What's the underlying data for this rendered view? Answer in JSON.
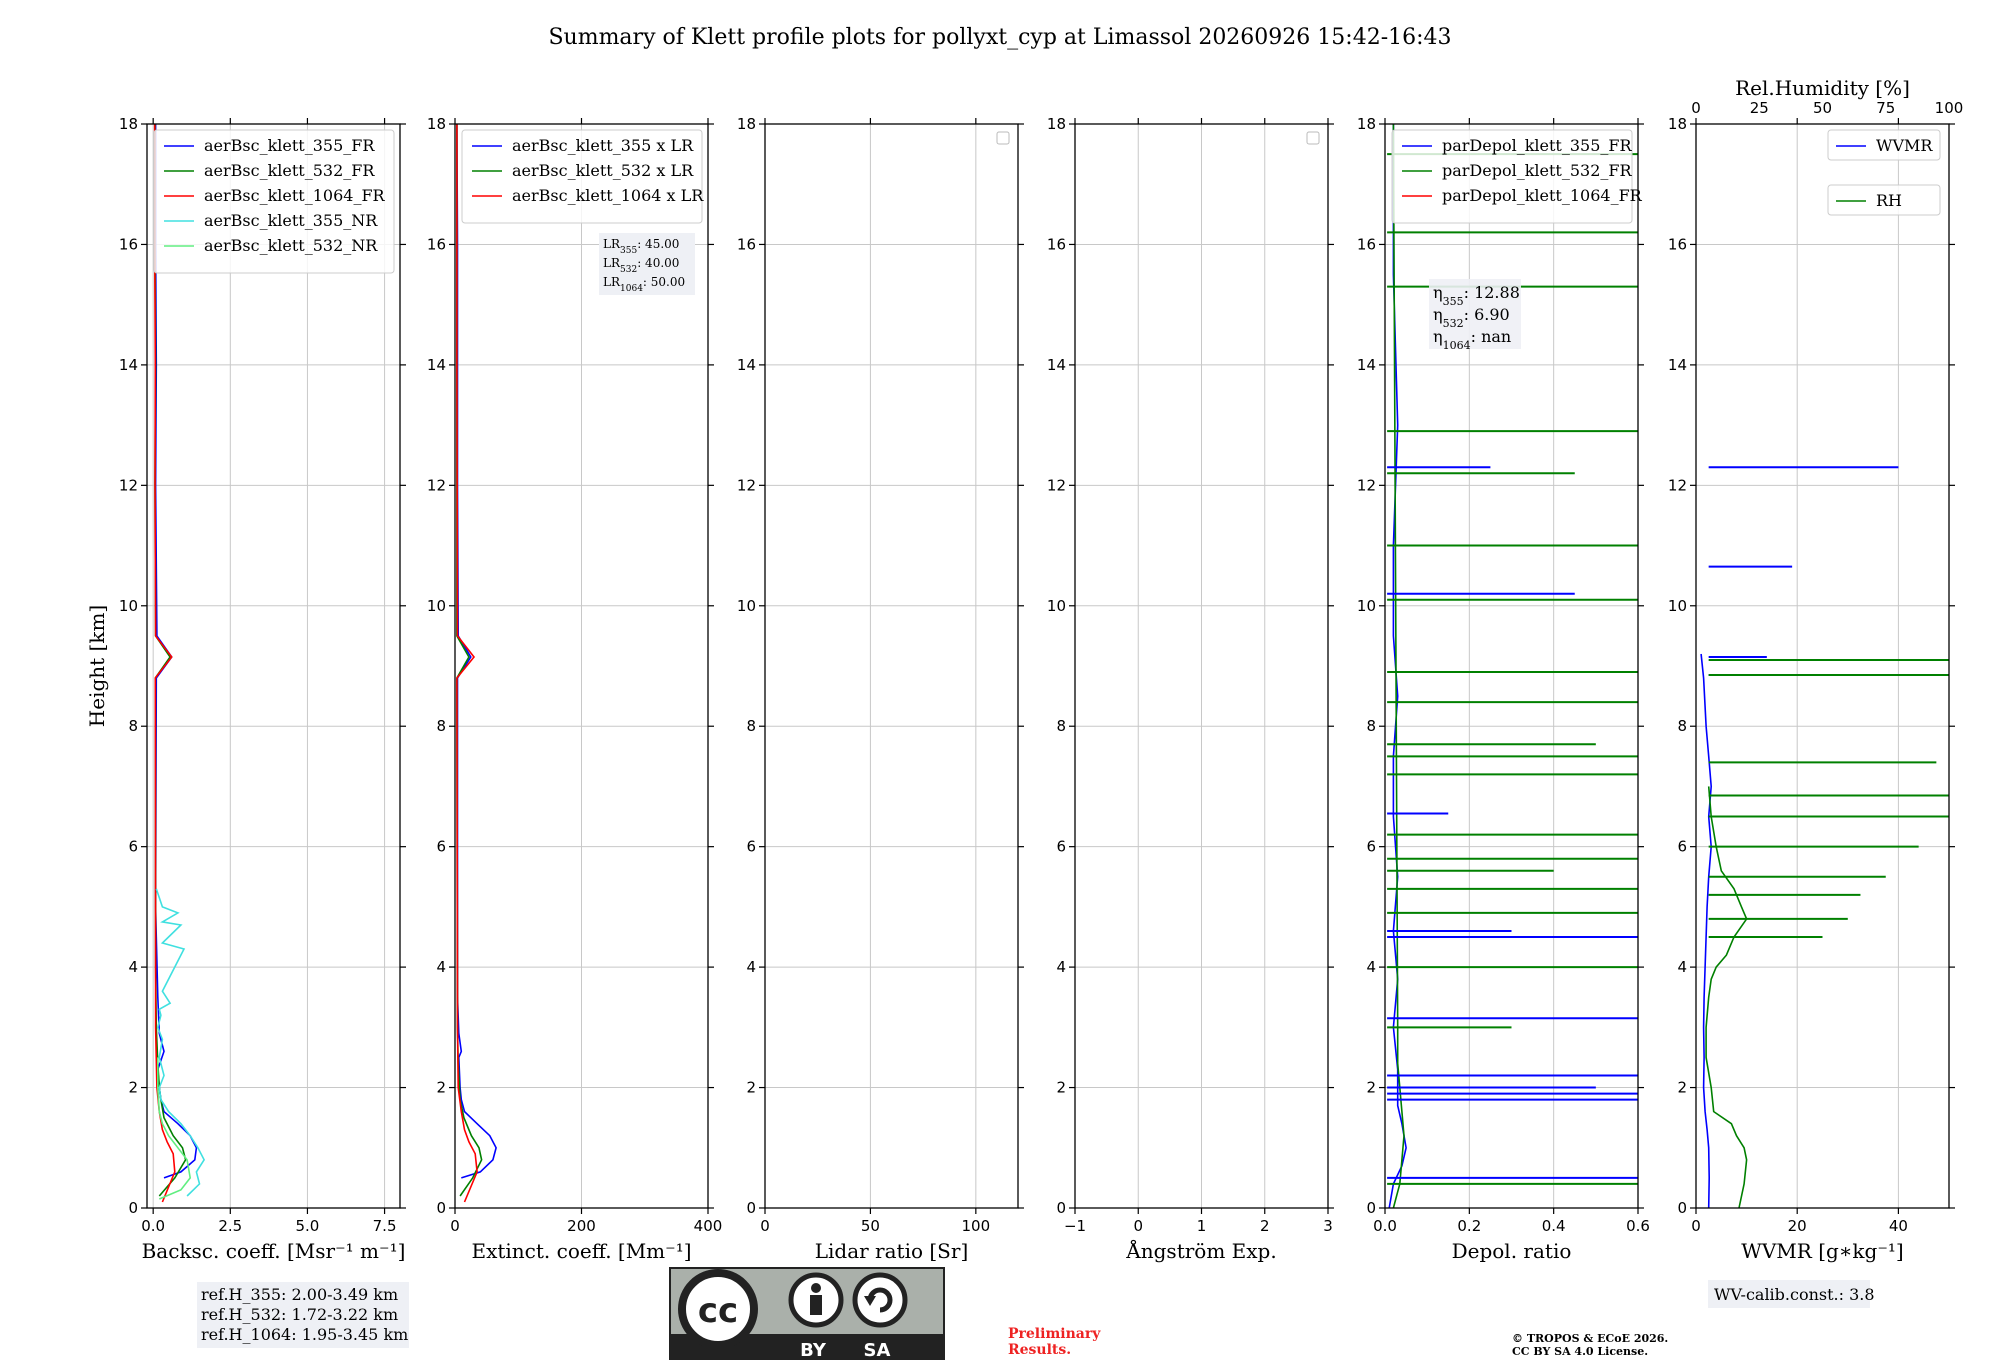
{
  "figure": {
    "title": "Summary of Klett profile plots for pollyxt_cyp at Limassol 20260926 15:42-16:43",
    "preliminary": [
      "Preliminary",
      "Results."
    ],
    "copyright": [
      "© TROPOS & ECoE 2026.",
      "CC BY SA 4.0 License."
    ],
    "cc_badge": {
      "left": "BY",
      "right": "SA"
    },
    "colors": {
      "blue": "#0000ff",
      "green": "#008000",
      "red": "#ff0000",
      "cyan": "#40e0e0",
      "lightgreen": "#60ee80",
      "grid": "#c8c8c8"
    }
  },
  "chart_data": [
    {
      "type": "line",
      "xlabel": "Backsc. coeff. [Msr⁻¹ m⁻¹]",
      "ylabel": "Height [km]",
      "xlim": [
        -0.2,
        8.0
      ],
      "ylim": [
        0,
        18
      ],
      "xticks": [
        0,
        2.5,
        5.0,
        7.5
      ],
      "xtick_labels": [
        "0.0",
        "2.5",
        "5.0",
        "7.5"
      ],
      "yticks": [
        0,
        2,
        4,
        6,
        8,
        10,
        12,
        14,
        16,
        18
      ],
      "legend": {
        "loc": "upper-right",
        "entries": [
          {
            "name": "aerBsc_klett_355_FR",
            "color": "#0000ff"
          },
          {
            "name": "aerBsc_klett_532_FR",
            "color": "#008000"
          },
          {
            "name": "aerBsc_klett_1064_FR",
            "color": "#ff0000"
          },
          {
            "name": "aerBsc_klett_355_NR",
            "color": "#40e0e0"
          },
          {
            "name": "aerBsc_klett_532_NR",
            "color": "#60ee80"
          }
        ]
      },
      "series": [
        {
          "name": "aerBsc_klett_355_FR",
          "color": "#0000ff",
          "x": [
            0.35,
            0.9,
            1.35,
            1.4,
            1.2,
            0.8,
            0.35,
            0.25,
            0.2,
            0.15,
            0.35,
            0.2,
            0.15,
            0.1,
            0.08,
            0.1,
            0.6,
            0.12,
            0.08,
            0.1,
            0.08,
            0.08
          ],
          "y": [
            0.5,
            0.6,
            0.8,
            1.0,
            1.2,
            1.4,
            1.6,
            1.8,
            2.0,
            2.3,
            2.6,
            2.9,
            3.5,
            4.5,
            5.0,
            8.8,
            9.15,
            9.5,
            12.0,
            14.0,
            16.0,
            18.0
          ]
        },
        {
          "name": "aerBsc_klett_532_FR",
          "color": "#008000",
          "x": [
            0.2,
            0.7,
            1.05,
            0.95,
            0.65,
            0.35,
            0.25,
            0.2,
            0.15,
            0.1,
            0.08,
            0.07,
            0.55,
            0.08,
            0.06,
            0.08,
            0.06,
            0.06
          ],
          "y": [
            0.2,
            0.5,
            0.8,
            1.0,
            1.2,
            1.5,
            1.8,
            2.0,
            2.4,
            3.0,
            4.0,
            8.8,
            9.15,
            9.5,
            12.0,
            14.0,
            16.0,
            18.0
          ]
        },
        {
          "name": "aerBsc_klett_1064_FR",
          "color": "#ff0000",
          "x": [
            0.3,
            0.7,
            0.65,
            0.45,
            0.3,
            0.2,
            0.12,
            0.08,
            0.07,
            0.6,
            0.08,
            0.06,
            0.07,
            0.05,
            0.05
          ],
          "y": [
            0.1,
            0.6,
            0.9,
            1.1,
            1.3,
            1.6,
            2.0,
            3.0,
            8.8,
            9.15,
            9.5,
            12.0,
            14.0,
            16.0,
            18.0
          ]
        },
        {
          "name": "aerBsc_klett_355_NR",
          "color": "#40e0e0",
          "x": [
            1.1,
            1.5,
            1.4,
            1.65,
            1.45,
            1.2,
            0.9,
            0.5,
            0.25,
            0.2,
            0.35,
            0.2,
            0.3,
            0.15,
            0.25,
            0.2,
            0.55,
            0.3,
            1.0,
            0.3,
            0.9,
            0.3,
            0.8,
            0.3,
            0.1
          ],
          "y": [
            0.2,
            0.4,
            0.6,
            0.8,
            1.0,
            1.2,
            1.4,
            1.6,
            1.8,
            2.0,
            2.2,
            2.5,
            2.8,
            3.0,
            3.2,
            3.3,
            3.4,
            3.6,
            4.3,
            4.4,
            4.7,
            4.75,
            4.9,
            5.0,
            5.3
          ]
        },
        {
          "name": "aerBsc_klett_532_NR",
          "color": "#60ee80",
          "x": [
            0.2,
            0.9,
            1.2,
            1.1,
            0.8,
            0.5,
            0.3,
            0.2,
            0.15,
            0.15
          ],
          "y": [
            0.15,
            0.3,
            0.5,
            0.8,
            1.0,
            1.2,
            1.4,
            1.6,
            2.0,
            2.5
          ]
        }
      ],
      "annotation": [
        "ref.H_355: 2.00-3.49 km",
        "ref.H_532: 1.72-3.22 km",
        "ref.H_1064: 1.95-3.45 km"
      ]
    },
    {
      "type": "line",
      "xlabel": "Extinct. coeff. [Mm⁻¹]",
      "xlim": [
        0,
        400
      ],
      "ylim": [
        0,
        18
      ],
      "xticks": [
        0,
        200,
        400
      ],
      "xtick_labels": [
        "0",
        "200",
        "400"
      ],
      "yticks": [
        0,
        2,
        4,
        6,
        8,
        10,
        12,
        14,
        16,
        18
      ],
      "legend": {
        "loc": "upper-right",
        "entries": [
          {
            "name": "aerBsc_klett_355 x LR",
            "color": "#0000ff"
          },
          {
            "name": "aerBsc_klett_532 x LR",
            "color": "#008000"
          },
          {
            "name": "aerBsc_klett_1064 x LR",
            "color": "#ff0000"
          }
        ]
      },
      "series": [
        {
          "name": "aerBsc_klett_355 x LR",
          "color": "#0000ff",
          "x": [
            10,
            40,
            60,
            65,
            55,
            35,
            15,
            10,
            8,
            6,
            10,
            6,
            4,
            4,
            25,
            5,
            4,
            4,
            3
          ],
          "y": [
            0.5,
            0.6,
            0.8,
            1.0,
            1.2,
            1.4,
            1.6,
            1.8,
            2.0,
            2.5,
            2.6,
            2.9,
            3.5,
            8.8,
            9.15,
            9.5,
            12.0,
            16.0,
            18.0
          ]
        },
        {
          "name": "aerBsc_klett_532 x LR",
          "color": "#008000",
          "x": [
            8,
            28,
            42,
            38,
            26,
            14,
            8,
            5,
            4,
            3,
            22,
            3,
            3,
            3
          ],
          "y": [
            0.2,
            0.5,
            0.8,
            1.0,
            1.2,
            1.5,
            1.8,
            2.4,
            3.0,
            8.8,
            9.15,
            9.5,
            14.0,
            18.0
          ]
        },
        {
          "name": "aerBsc_klett_1064 x LR",
          "color": "#ff0000",
          "x": [
            15,
            35,
            32,
            22,
            15,
            10,
            5,
            4,
            3,
            30,
            4,
            3,
            3
          ],
          "y": [
            0.1,
            0.6,
            0.9,
            1.1,
            1.3,
            1.6,
            2.0,
            3.0,
            8.8,
            9.15,
            9.5,
            14.0,
            18.0
          ]
        }
      ],
      "annotation": [
        {
          "base": "LR",
          "sub": "355",
          "value": ": 45.00"
        },
        {
          "base": "LR",
          "sub": "532",
          "value": ": 40.00"
        },
        {
          "base": "LR",
          "sub": "1064",
          "value": ": 50.00"
        }
      ]
    },
    {
      "type": "line",
      "xlabel": "Lidar ratio [Sr]",
      "xlim": [
        0,
        120
      ],
      "ylim": [
        0,
        18
      ],
      "xticks": [
        0,
        50,
        100
      ],
      "xtick_labels": [
        "0",
        "50",
        "100"
      ],
      "yticks": [
        0,
        2,
        4,
        6,
        8,
        10,
        12,
        14,
        16,
        18
      ],
      "legend": {
        "loc": "upper-right",
        "entries": []
      },
      "series": []
    },
    {
      "type": "line",
      "xlabel": "Ångström Exp.",
      "xlim": [
        -1,
        3
      ],
      "ylim": [
        0,
        18
      ],
      "xticks": [
        -1,
        0,
        1,
        2,
        3
      ],
      "xtick_labels": [
        "−1",
        "0",
        "1",
        "2",
        "3"
      ],
      "yticks": [
        0,
        2,
        4,
        6,
        8,
        10,
        12,
        14,
        16,
        18
      ],
      "legend": {
        "loc": "upper-right",
        "entries": []
      },
      "series": []
    },
    {
      "type": "line",
      "xlabel": "Depol. ratio",
      "xlim": [
        0,
        0.6
      ],
      "ylim": [
        0,
        18
      ],
      "xticks": [
        0,
        0.2,
        0.4,
        0.6
      ],
      "xtick_labels": [
        "0.0",
        "0.2",
        "0.4",
        "0.6"
      ],
      "yticks": [
        0,
        2,
        4,
        6,
        8,
        10,
        12,
        14,
        16,
        18
      ],
      "legend": {
        "loc": "upper-right",
        "entries": [
          {
            "name": "parDepol_klett_355_FR",
            "color": "#0000ff"
          },
          {
            "name": "parDepol_klett_532_FR",
            "color": "#008000"
          },
          {
            "name": "parDepol_klett_1064_FR",
            "color": "#ff0000"
          }
        ]
      },
      "series": [
        {
          "name": "parDepol_klett_355_FR",
          "color": "#0000ff",
          "x": [
            0.01,
            0.02,
            0.04,
            0.05,
            0.04,
            0.03,
            0.03,
            0.02,
            0.03,
            0.02,
            0.03,
            0.02,
            0.02,
            0.03,
            0.02,
            0.02,
            0.03,
            0.02,
            0.02
          ],
          "y": [
            0.0,
            0.4,
            0.7,
            1.0,
            1.4,
            1.7,
            2.3,
            3.0,
            3.8,
            4.6,
            5.5,
            6.5,
            7.5,
            8.5,
            9.5,
            11.0,
            13.0,
            15.5,
            18.0
          ]
        },
        {
          "name": "parDepol_klett_532_FR",
          "color": "#008000",
          "x": [
            0.02,
            0.035,
            0.04,
            0.045,
            0.04,
            0.035,
            0.03,
            0.03,
            0.02
          ],
          "y": [
            0.0,
            0.4,
            0.8,
            1.2,
            1.6,
            2.0,
            2.4,
            3.0,
            18.0
          ]
        }
      ],
      "spikes": [
        {
          "color": "#0000ff",
          "x": [
            0.6,
            0.6,
            0.6,
            0.5,
            0.6,
            0.6,
            0.3,
            0.6,
            0.15,
            0.45,
            0.25
          ],
          "y": [
            0.5,
            1.8,
            1.9,
            2.0,
            2.2,
            3.15,
            4.6,
            4.5,
            6.55,
            10.2,
            12.3
          ]
        },
        {
          "color": "#008000",
          "x": [
            0.6,
            0.3,
            0.6,
            0.6,
            0.6,
            0.4,
            0.6,
            0.6,
            0.6,
            0.6,
            0.5,
            0.6,
            0.6,
            0.6,
            0.6,
            0.45,
            0.6,
            0.6,
            0.6,
            0.6
          ],
          "y": [
            0.4,
            3.0,
            4.0,
            4.9,
            5.3,
            5.6,
            5.8,
            6.2,
            7.2,
            7.5,
            7.7,
            8.4,
            8.9,
            10.1,
            11.0,
            12.2,
            12.9,
            15.3,
            16.2,
            17.5
          ]
        }
      ],
      "annotation": [
        {
          "base": "η",
          "sub": "355",
          "value": ": 12.88"
        },
        {
          "base": "η",
          "sub": "532",
          "value": ": 6.90"
        },
        {
          "base": "η",
          "sub": "1064",
          "value": ": nan"
        }
      ]
    },
    {
      "type": "line",
      "xlabel": "WVMR [g∗kg⁻¹]",
      "x2label": "Rel.Humidity [%]",
      "xlim": [
        0,
        50
      ],
      "x2lim": [
        0,
        100
      ],
      "ylim": [
        0,
        18
      ],
      "xticks": [
        0,
        20,
        40
      ],
      "xtick_labels": [
        "0",
        "20",
        "40"
      ],
      "x2ticks": [
        0,
        25,
        50,
        75,
        100
      ],
      "x2tick_labels": [
        "0",
        "25",
        "50",
        "75",
        "100"
      ],
      "yticks": [
        0,
        2,
        4,
        6,
        8,
        10,
        12,
        14,
        16,
        18
      ],
      "legend": {
        "loc": "upper-right",
        "entries": [
          {
            "name": "WVMR",
            "color": "#0000ff"
          },
          {
            "name": "RH",
            "color": "#008000"
          }
        ]
      },
      "series": [
        {
          "name": "WVMR",
          "color": "#0000ff",
          "x": [
            2.5,
            2.6,
            2.5,
            2.2,
            1.8,
            1.5,
            1.6,
            1.5,
            1.6,
            1.8,
            2.0,
            2.2,
            2.5,
            3.0,
            2.5,
            3.0,
            2.5,
            2.0,
            1.5,
            1.0
          ],
          "y": [
            0.0,
            0.5,
            1.0,
            1.3,
            1.6,
            2.0,
            2.5,
            3.0,
            3.5,
            4.0,
            4.5,
            5.0,
            5.5,
            6.0,
            6.5,
            7.0,
            7.5,
            8.0,
            8.8,
            9.2
          ]
        },
        {
          "name": "RH",
          "color": "#008000",
          "x": [
            17,
            19,
            20,
            19,
            16,
            14,
            7,
            6,
            4,
            4,
            5,
            6,
            8,
            12,
            15,
            20,
            18,
            15,
            10,
            8,
            6,
            5
          ],
          "y": [
            0.0,
            0.4,
            0.8,
            1.0,
            1.2,
            1.4,
            1.6,
            2.0,
            2.5,
            3.0,
            3.5,
            3.8,
            4.0,
            4.2,
            4.5,
            4.8,
            5.0,
            5.3,
            5.6,
            6.0,
            6.5,
            7.0
          ]
        }
      ],
      "spikes_wvmr": {
        "x": [
          40,
          19,
          14,
          10
        ],
        "y": [
          12.3,
          10.65,
          9.15,
          8.85
        ]
      },
      "spikes_rh": {
        "x": [
          100,
          100,
          95,
          100,
          100,
          88,
          75,
          65,
          60,
          50
        ],
        "y": [
          9.1,
          8.85,
          7.4,
          6.85,
          6.5,
          6.0,
          5.5,
          5.2,
          4.8,
          4.5
        ]
      },
      "annotation": [
        "WV-calib.const.: 3.8"
      ]
    }
  ]
}
